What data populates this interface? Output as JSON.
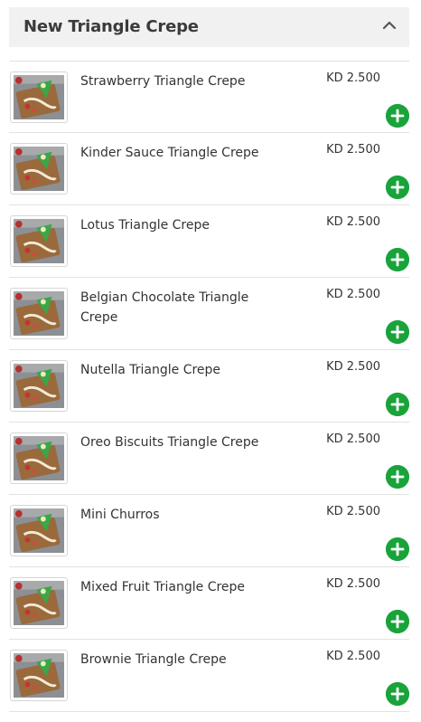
{
  "section": {
    "title": "New Triangle Crepe",
    "collapse_icon": "chevron-up-icon",
    "accent_color": "#1aa33b",
    "items": [
      {
        "name": "Strawberry Triangle Crepe",
        "price": "KD 2.500",
        "add_icon": "plus-icon"
      },
      {
        "name": "Kinder Sauce Triangle Crepe",
        "price": "KD 2.500",
        "add_icon": "plus-icon"
      },
      {
        "name": "Lotus Triangle Crepe",
        "price": "KD 2.500",
        "add_icon": "plus-icon"
      },
      {
        "name": "Belgian Chocolate Triangle Crepe",
        "price": "KD 2.500",
        "add_icon": "plus-icon"
      },
      {
        "name": "Nutella Triangle Crepe",
        "price": "KD 2.500",
        "add_icon": "plus-icon"
      },
      {
        "name": "Oreo Biscuits Triangle Crepe",
        "price": "KD 2.500",
        "add_icon": "plus-icon"
      },
      {
        "name": "Mini Churros",
        "price": "KD 2.500",
        "add_icon": "plus-icon"
      },
      {
        "name": "Mixed Fruit Triangle Crepe",
        "price": "KD 2.500",
        "add_icon": "plus-icon"
      },
      {
        "name": "Brownie Triangle Crepe",
        "price": "KD 2.500",
        "add_icon": "plus-icon"
      }
    ]
  }
}
